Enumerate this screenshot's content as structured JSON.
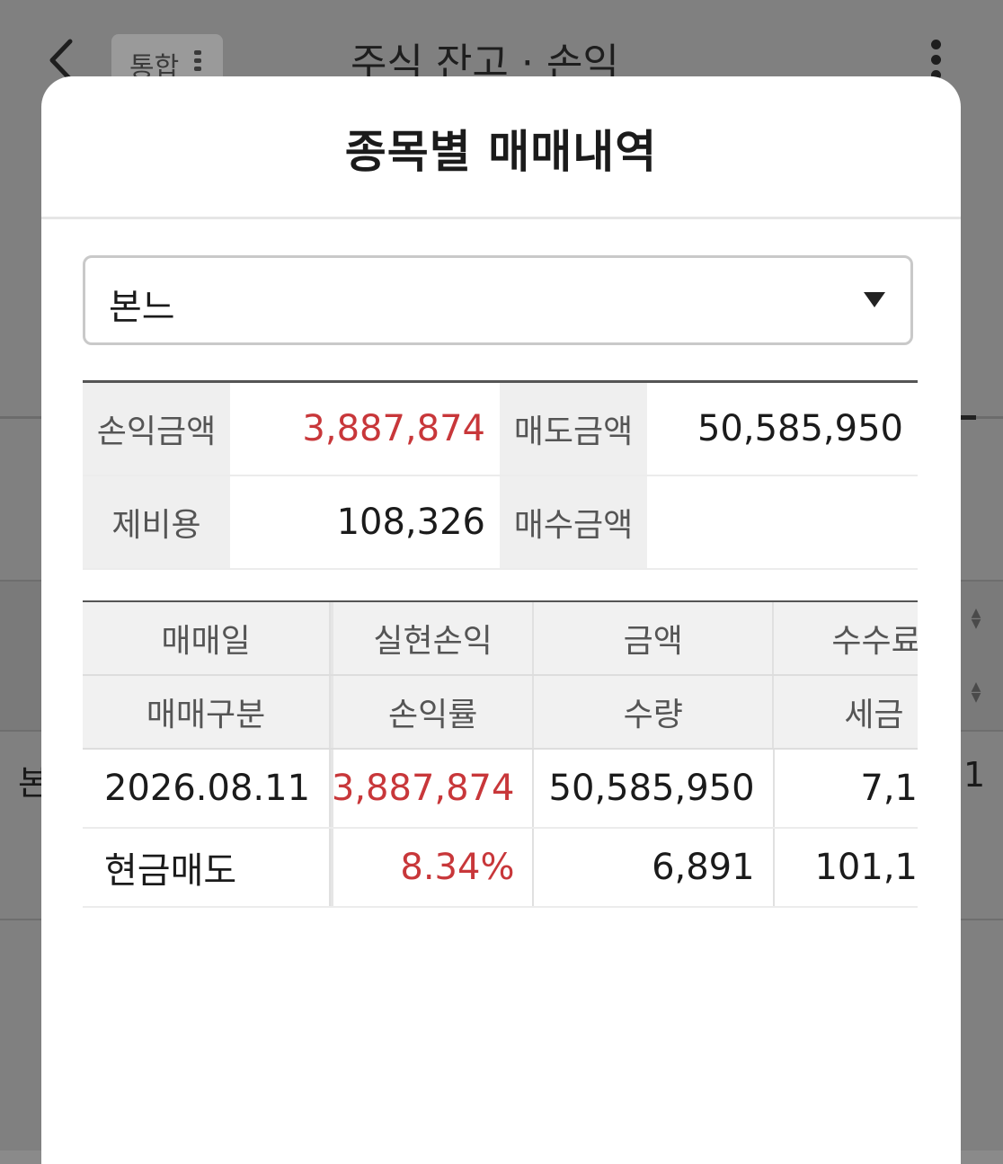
{
  "background": {
    "tab_chip": "통합",
    "title": "주식 잔고 · 손익",
    "left_fragment": "본",
    "right_fragment": "1"
  },
  "modal": {
    "title": "종목별 매매내역",
    "select": {
      "value": "본느"
    },
    "summary": {
      "pnl_label": "손익금액",
      "pnl_value": "3,887,874",
      "sell_label": "매도금액",
      "sell_value": "50,585,950",
      "fees_label": "제비용",
      "fees_value": "108,326",
      "buy_label": "매수금액",
      "buy_value": ""
    },
    "table": {
      "headers_row1": [
        "매매일",
        "실현손익",
        "금액",
        "수수료"
      ],
      "headers_row2": [
        "매매구분",
        "손익률",
        "수량",
        "세금"
      ],
      "rows": [
        [
          "2026.08.11",
          "3,887,874",
          "50,585,950",
          "7,1"
        ],
        [
          "현금매도",
          "8.34%",
          "6,891",
          "101,1"
        ]
      ]
    },
    "colors": {
      "profit": "#c8373a"
    }
  }
}
